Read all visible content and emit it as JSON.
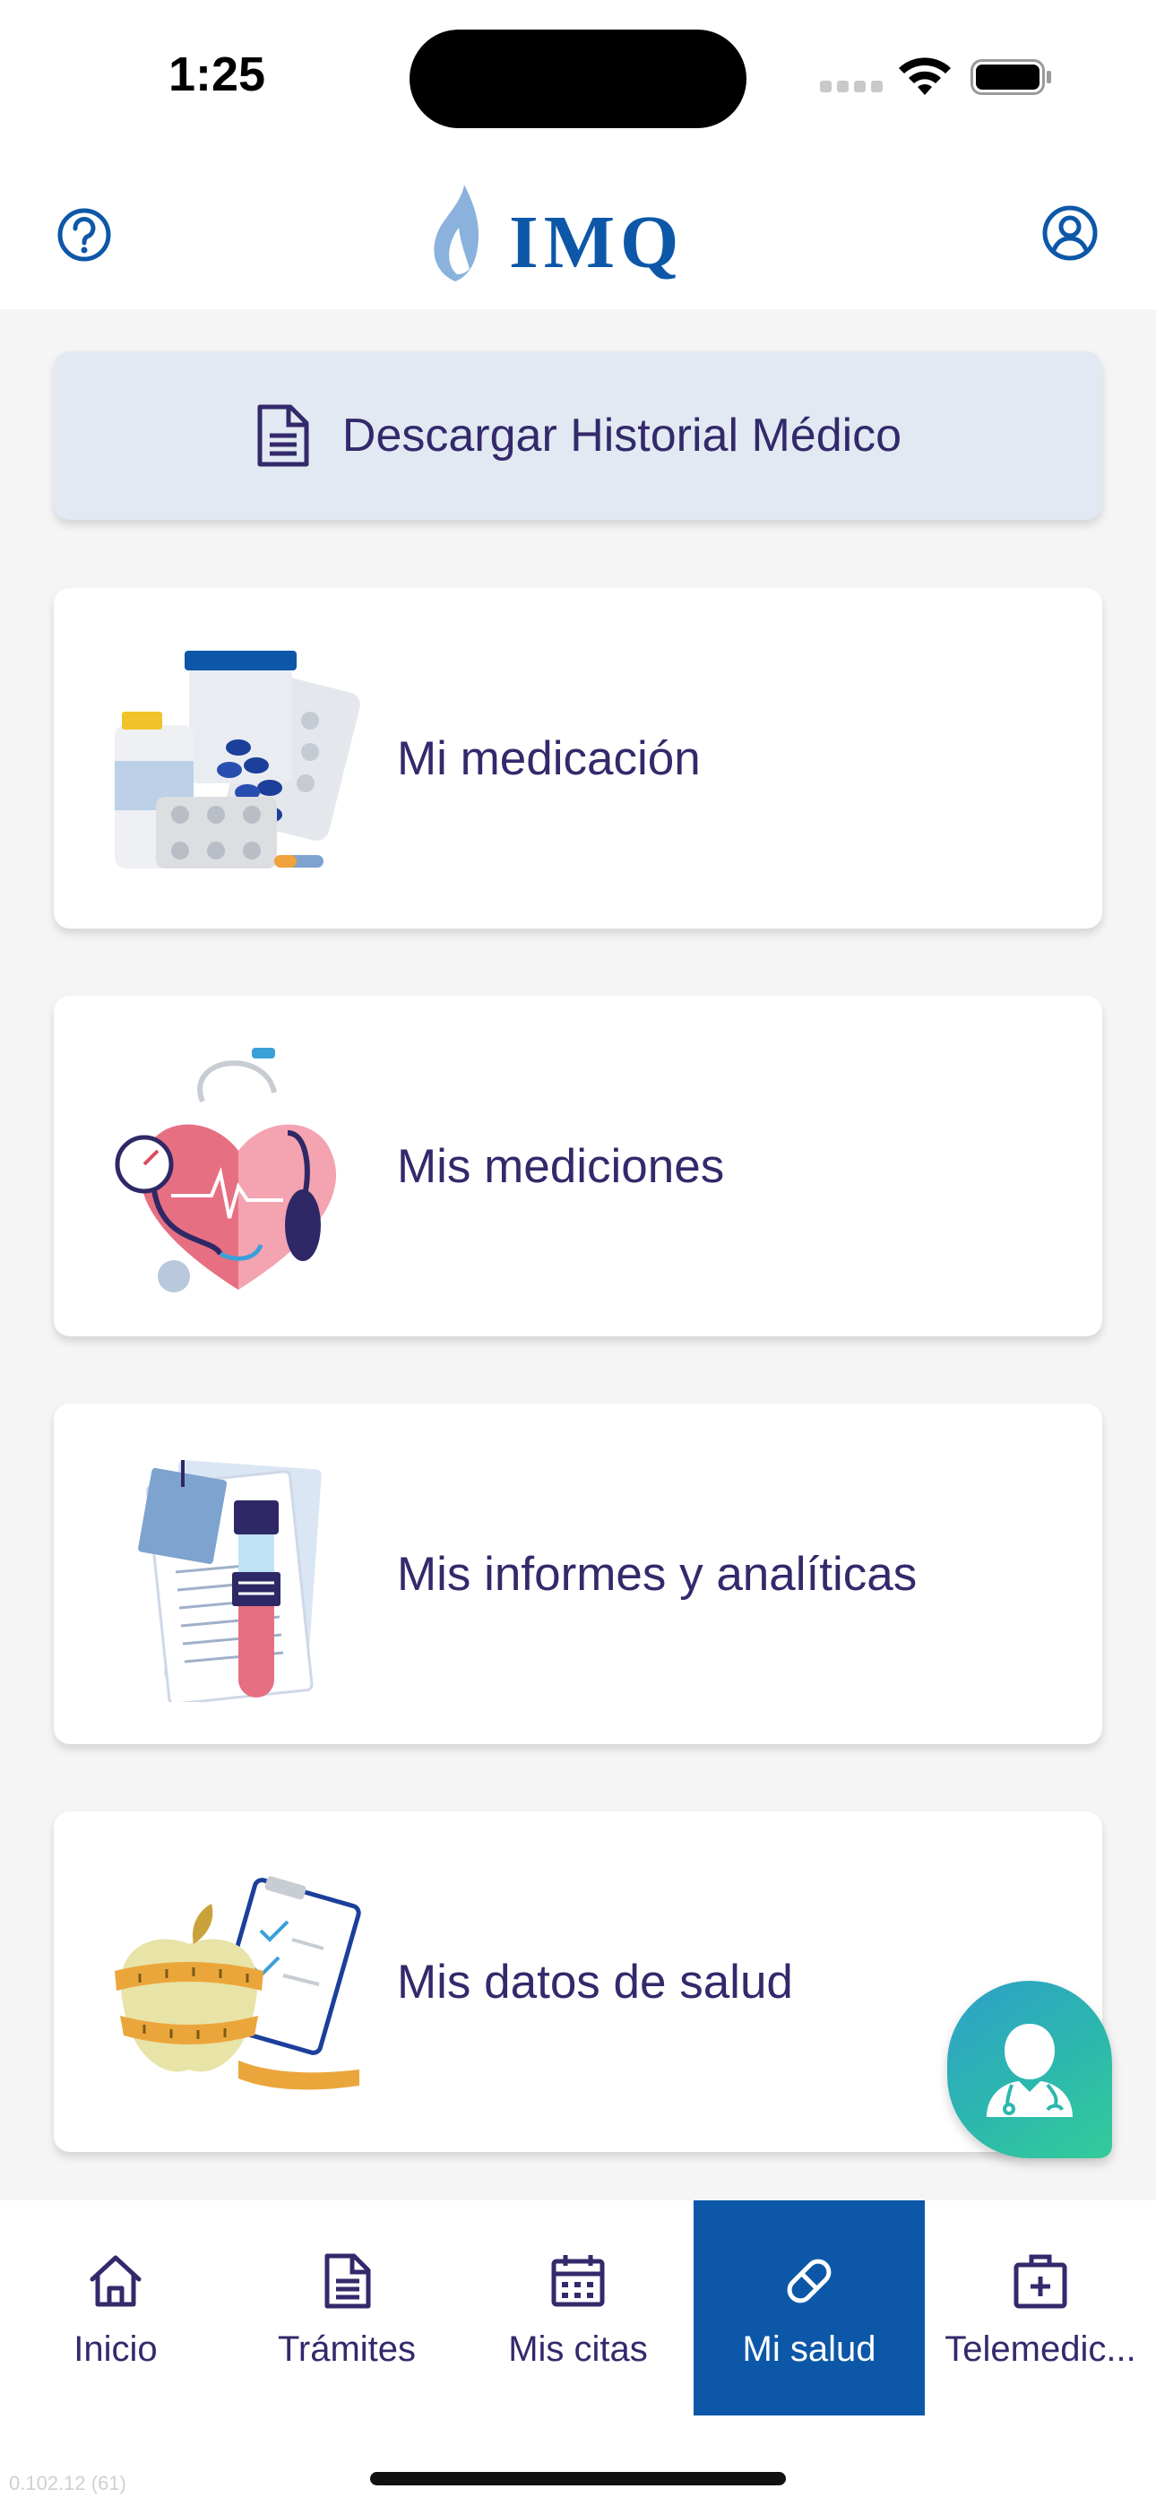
{
  "status_bar": {
    "time": "1:25"
  },
  "header": {
    "logo_text": "IMQ",
    "help_icon": "help-circle-icon",
    "profile_icon": "user-circle-icon"
  },
  "download": {
    "label": "Descargar Historial Médico",
    "icon": "document-icon"
  },
  "cards": [
    {
      "label": "Mi medicación",
      "icon": "medication-illustration"
    },
    {
      "label": "Mis mediciones",
      "icon": "measurements-illustration"
    },
    {
      "label": "Mis informes y analíticas",
      "icon": "reports-illustration"
    },
    {
      "label": "Mis datos de salud",
      "icon": "health-data-illustration"
    }
  ],
  "fab": {
    "icon": "doctor-icon"
  },
  "tabs": [
    {
      "label": "Inicio",
      "icon": "home-icon",
      "active": false
    },
    {
      "label": "Trámites",
      "icon": "document-icon",
      "active": false
    },
    {
      "label": "Mis citas",
      "icon": "calendar-icon",
      "active": false
    },
    {
      "label": "Mi salud",
      "icon": "pill-icon",
      "active": true
    },
    {
      "label": "Telemedic...",
      "icon": "medical-kit-icon",
      "active": false
    }
  ],
  "version": "0.102.12 (61)",
  "colors": {
    "brand_blue": "#0d57a8",
    "text_purple": "#33296b",
    "download_bg": "#e2e9f2",
    "fab_teal": "#2cb8ad"
  }
}
